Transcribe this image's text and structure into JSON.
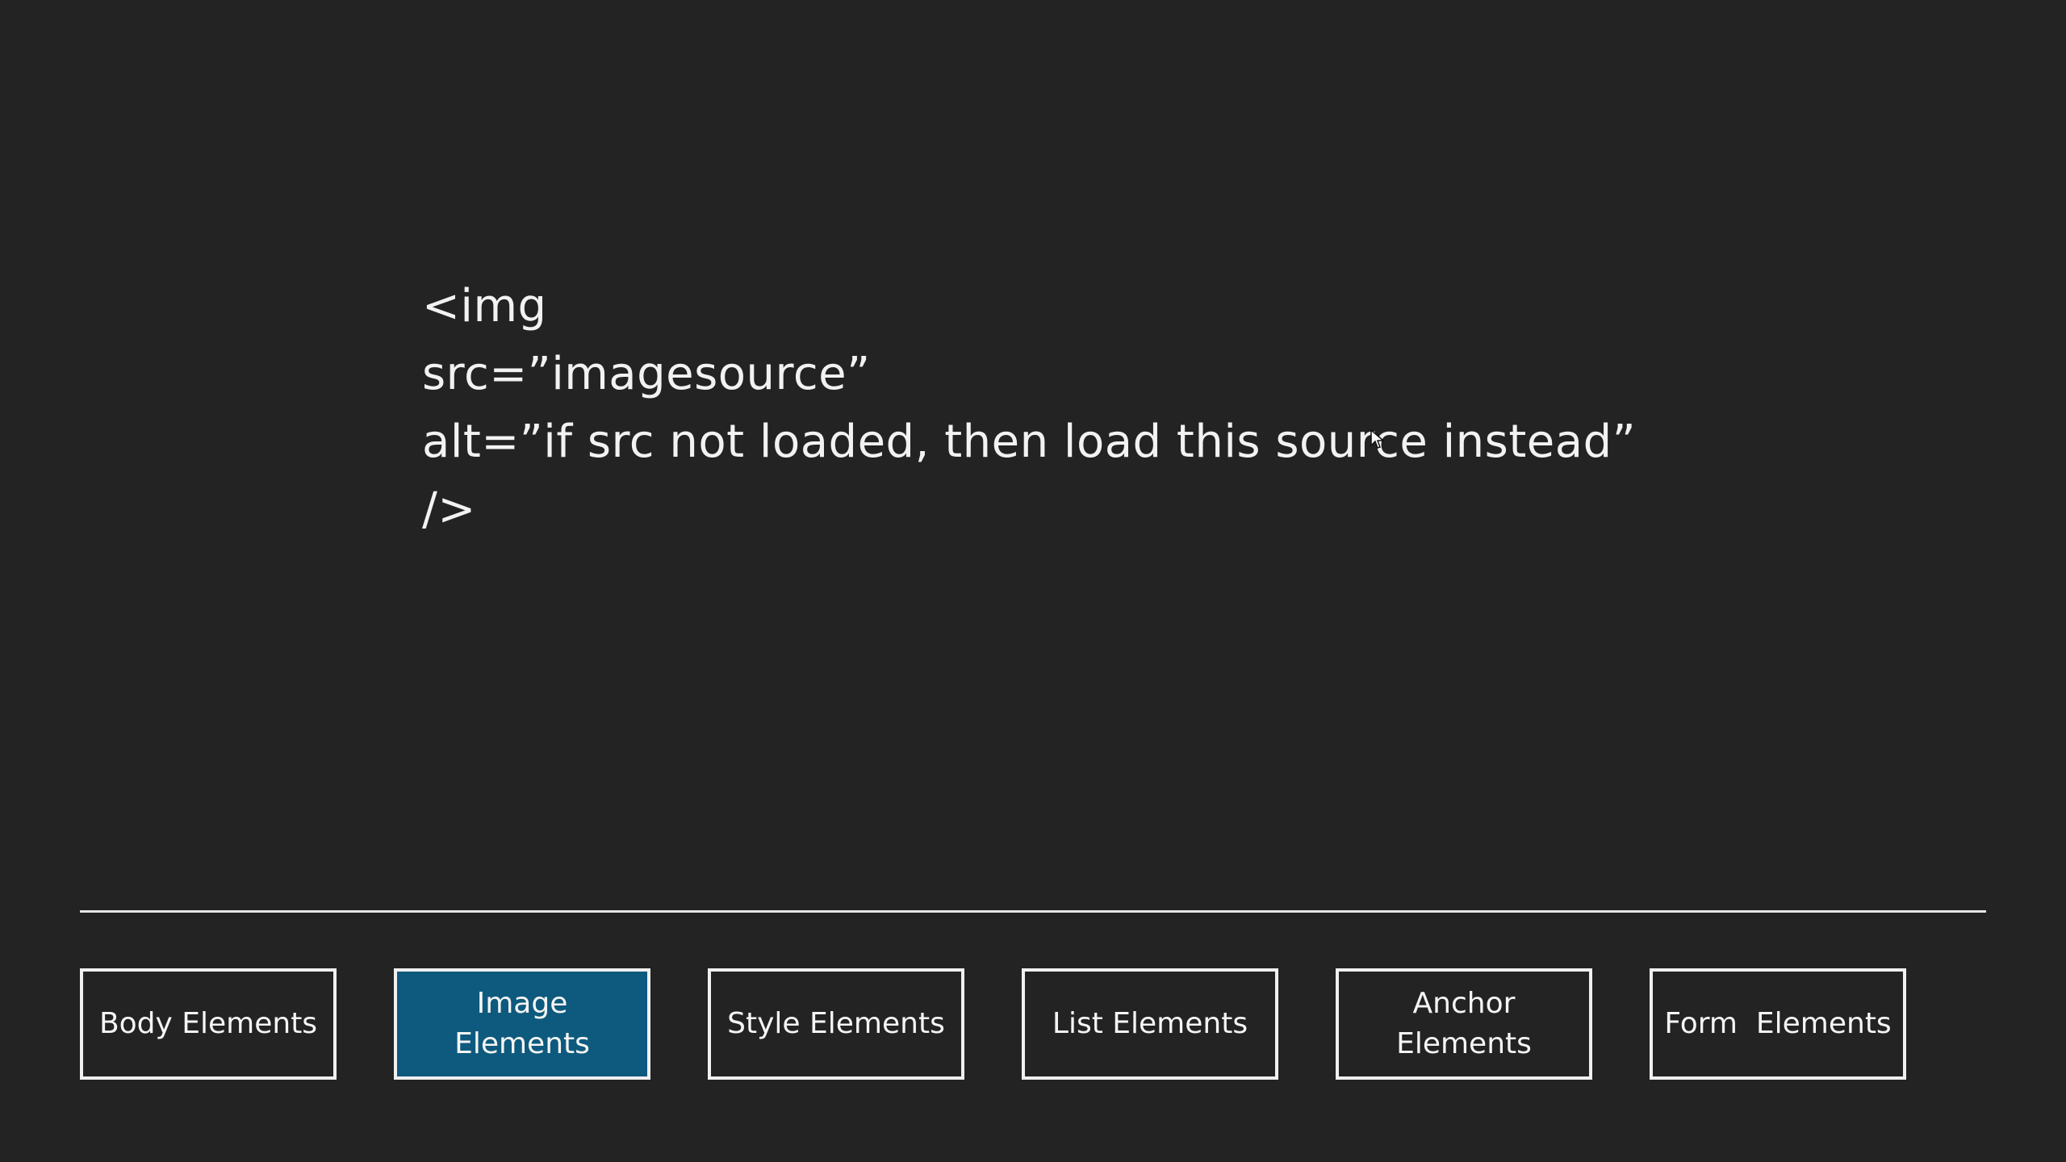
{
  "code": {
    "lines": [
      "<img",
      "src=”imagesource”",
      "alt=”if src not loaded, then load this source instead”",
      "/>"
    ]
  },
  "nav": {
    "buttons": [
      {
        "label": "Body Elements",
        "active": false
      },
      {
        "label": "Image Elements",
        "active": true
      },
      {
        "label": "Style Elements",
        "active": false
      },
      {
        "label": "List Elements",
        "active": false
      },
      {
        "label": "Anchor Elements",
        "active": false
      },
      {
        "label": "Form  Elements",
        "active": false
      }
    ]
  },
  "colors": {
    "background": "#232323",
    "text": "#f2f2f2",
    "active_button": "#0e5a7e",
    "border": "#f0f0f0"
  }
}
